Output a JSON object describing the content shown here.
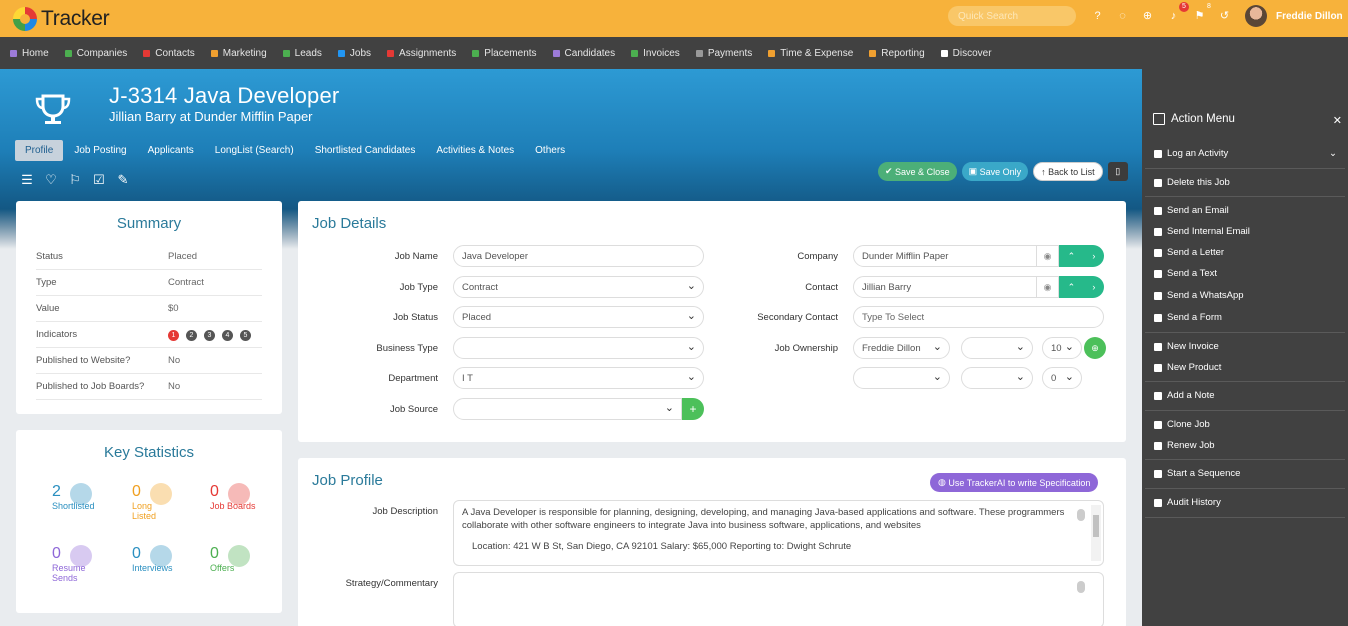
{
  "app": {
    "name": "Tracker",
    "search_placeholder": "Quick Search",
    "username": "Freddie Dillon",
    "badges": {
      "notifications": "5",
      "flags": "8"
    }
  },
  "nav": [
    "Home",
    "Companies",
    "Contacts",
    "Marketing",
    "Leads",
    "Jobs",
    "Assignments",
    "Placements",
    "Candidates",
    "Invoices",
    "Payments",
    "Time & Expense",
    "Reporting",
    "Discover"
  ],
  "nav_colors": [
    "#9c7bd8",
    "#4caf50",
    "#e53935",
    "#f0a030",
    "#4caf50",
    "#2196f3",
    "#e53935",
    "#4caf50",
    "#9c7bd8",
    "#4caf50",
    "#999999",
    "#f0a030",
    "#f0a030",
    "#ffffff"
  ],
  "job": {
    "title": "J-3314 Java Developer",
    "subtitle": "Jillian Barry at Dunder Mifflin Paper"
  },
  "tabs": [
    "Profile",
    "Job Posting",
    "Applicants",
    "LongList (Search)",
    "Shortlisted Candidates",
    "Activities & Notes",
    "Others"
  ],
  "buttons": {
    "save_close": "Save & Close",
    "save_only": "Save Only",
    "back_to_list": "Back to List"
  },
  "summary": {
    "title": "Summary",
    "rows": [
      {
        "k": "Status",
        "v": "Placed"
      },
      {
        "k": "Type",
        "v": "Contract"
      },
      {
        "k": "Value",
        "v": "$0"
      },
      {
        "k": "Indicators",
        "v": ""
      },
      {
        "k": "Published to Website?",
        "v": "No"
      },
      {
        "k": "Published to Job Boards?",
        "v": "No"
      }
    ],
    "indicators": [
      "1",
      "2",
      "3",
      "4",
      "5"
    ]
  },
  "key_stats": {
    "title": "Key Statistics",
    "items": [
      {
        "num": "2",
        "label": "Shortlisted",
        "color": "#2a8fc0"
      },
      {
        "num": "0",
        "label": "Long Listed",
        "color": "#f0a020"
      },
      {
        "num": "0",
        "label": "Job Boards",
        "color": "#e53935"
      },
      {
        "num": "0",
        "label": "Resume Sends",
        "color": "#8e67d8"
      },
      {
        "num": "0",
        "label": "Interviews",
        "color": "#2a8fc0"
      },
      {
        "num": "0",
        "label": "Offers",
        "color": "#4caf50"
      }
    ]
  },
  "job_details": {
    "title": "Job Details",
    "job_name": {
      "label": "Job Name",
      "value": "Java Developer"
    },
    "job_type": {
      "label": "Job Type",
      "value": "Contract"
    },
    "job_status": {
      "label": "Job Status",
      "value": "Placed"
    },
    "business_type": {
      "label": "Business Type",
      "value": ""
    },
    "department": {
      "label": "Department",
      "value": "I T"
    },
    "job_source": {
      "label": "Job Source",
      "value": ""
    },
    "company": {
      "label": "Company",
      "value": "Dunder Mifflin Paper"
    },
    "contact": {
      "label": "Contact",
      "value": "Jillian Barry"
    },
    "secondary_contact": {
      "label": "Secondary Contact",
      "placeholder": "Type To Select"
    },
    "job_ownership": {
      "label": "Job Ownership",
      "owner": "Freddie Dillon",
      "pct": "10",
      "pct2": "0"
    }
  },
  "job_profile": {
    "title": "Job Profile",
    "ai_button": "Use TrackerAI to write Specification",
    "description_label": "Job Description",
    "description": "A Java Developer is responsible for planning, designing, developing, and managing Java-based applications and software. These programmers collaborate with other software engineers to integrate Java into business software, applications, and websites",
    "description_extra": "Location: 421 W B St, San Diego, CA 92101 Salary: $65,000 Reporting to: Dwight Schrute",
    "strategy_label": "Strategy/Commentary"
  },
  "action_menu": {
    "title": "Action Menu",
    "items": [
      "Log an Activity",
      "Delete this Job",
      "Send an Email",
      "Send Internal Email",
      "Send a Letter",
      "Send a Text",
      "Send a WhatsApp",
      "Send a Form",
      "New Invoice",
      "New Product",
      "Add a Note",
      "Clone Job",
      "Renew Job",
      "Start a Sequence",
      "Audit History"
    ]
  }
}
